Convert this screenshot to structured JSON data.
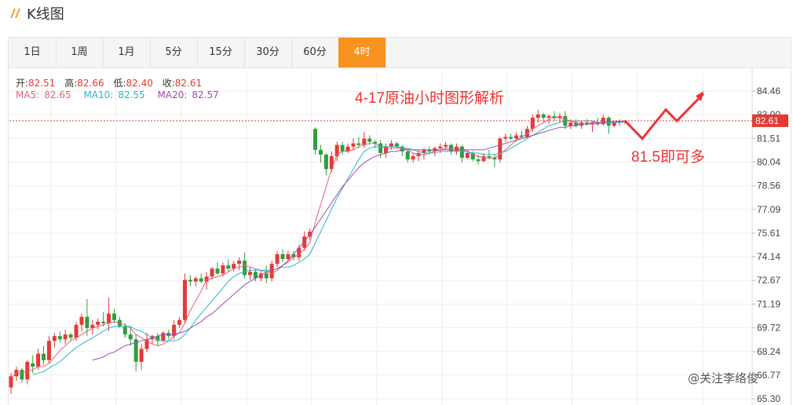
{
  "header": {
    "title": "K线图"
  },
  "tabs": [
    {
      "label": "1日",
      "active": false
    },
    {
      "label": "1周",
      "active": false
    },
    {
      "label": "1月",
      "active": false
    },
    {
      "label": "5分",
      "active": false
    },
    {
      "label": "15分",
      "active": false
    },
    {
      "label": "30分",
      "active": false
    },
    {
      "label": "60分",
      "active": false
    },
    {
      "label": "4时",
      "active": true
    }
  ],
  "ohlc": {
    "open_label": "开:",
    "open": "82.51",
    "high_label": "高:",
    "high": "82.66",
    "low_label": "低:",
    "low": "82.40",
    "close_label": "收:",
    "close": "82.61"
  },
  "ma": {
    "ma5_label": "MA5:",
    "ma5": "82.65",
    "ma10_label": "MA10:",
    "ma10": "82.55",
    "ma20_label": "MA20:",
    "ma20": "82.57"
  },
  "colors": {
    "up": "#e53935",
    "down": "#2e9e3e",
    "ma5": "#e8607a",
    "ma10": "#2bb5c8",
    "ma20": "#a44ab5",
    "accent": "#f7931e",
    "annotation": "#ee3333"
  },
  "annotations": {
    "headline": "4-17原油小时图形解析",
    "target": "81.5即可多",
    "watermark": "@关注李络俊"
  },
  "chart_data": {
    "type": "candlestick",
    "y_ticks": [
      "84.46",
      "83.00",
      "81.51",
      "80.04",
      "78.56",
      "77.09",
      "75.61",
      "74.14",
      "72.67",
      "71.19",
      "69.72",
      "68.24",
      "66.77",
      "65.30"
    ],
    "ylim": [
      65.3,
      84.46
    ],
    "current_price": "82.61",
    "grid": true,
    "candles": [
      [
        66.0,
        66.9,
        65.6,
        66.7
      ],
      [
        66.7,
        67.3,
        66.4,
        67.1
      ],
      [
        67.1,
        67.2,
        66.3,
        66.5
      ],
      [
        66.5,
        67.7,
        66.2,
        67.6
      ],
      [
        67.5,
        68.0,
        66.9,
        67.3
      ],
      [
        67.3,
        68.4,
        67.1,
        68.1
      ],
      [
        68.1,
        68.6,
        67.4,
        67.7
      ],
      [
        67.7,
        69.2,
        67.5,
        68.9
      ],
      [
        68.9,
        69.4,
        68.5,
        69.2
      ],
      [
        69.2,
        69.5,
        68.8,
        69.0
      ],
      [
        69.0,
        69.6,
        68.7,
        69.3
      ],
      [
        69.3,
        69.4,
        68.9,
        69.1
      ],
      [
        69.1,
        70.1,
        68.9,
        69.9
      ],
      [
        69.9,
        70.6,
        69.5,
        70.4
      ],
      [
        70.4,
        71.5,
        69.2,
        69.7
      ],
      [
        69.7,
        70.2,
        69.3,
        69.9
      ],
      [
        69.9,
        70.3,
        69.6,
        70.1
      ],
      [
        70.1,
        70.7,
        69.8,
        70.0
      ],
      [
        70.0,
        71.6,
        69.5,
        70.6
      ],
      [
        70.6,
        70.9,
        70.0,
        70.2
      ],
      [
        70.2,
        70.4,
        69.7,
        69.8
      ],
      [
        69.8,
        70.0,
        69.1,
        69.3
      ],
      [
        69.3,
        69.8,
        68.6,
        69.0
      ],
      [
        69.0,
        69.3,
        67.0,
        67.6
      ],
      [
        67.6,
        68.7,
        67.1,
        68.4
      ],
      [
        68.4,
        69.4,
        68.2,
        69.0
      ],
      [
        69.0,
        69.3,
        68.7,
        69.2
      ],
      [
        69.2,
        69.4,
        68.6,
        68.9
      ],
      [
        68.9,
        69.5,
        68.8,
        69.4
      ],
      [
        69.4,
        69.6,
        69.0,
        69.2
      ],
      [
        69.2,
        70.2,
        69.0,
        69.9
      ],
      [
        69.9,
        70.4,
        69.7,
        70.2
      ],
      [
        70.2,
        73.1,
        70.0,
        72.7
      ],
      [
        72.7,
        73.0,
        72.3,
        72.6
      ],
      [
        72.6,
        72.9,
        72.3,
        72.8
      ],
      [
        72.8,
        73.1,
        72.5,
        72.6
      ],
      [
        72.6,
        73.2,
        72.1,
        72.9
      ],
      [
        72.9,
        73.5,
        72.7,
        73.4
      ],
      [
        73.4,
        73.8,
        73.0,
        73.1
      ],
      [
        73.1,
        73.8,
        72.9,
        73.6
      ],
      [
        73.6,
        74.0,
        73.2,
        73.4
      ],
      [
        73.4,
        73.9,
        73.2,
        73.7
      ],
      [
        73.7,
        74.1,
        73.3,
        73.9
      ],
      [
        73.9,
        74.4,
        72.8,
        73.0
      ],
      [
        73.0,
        73.5,
        72.7,
        73.2
      ],
      [
        73.2,
        73.4,
        72.6,
        72.8
      ],
      [
        72.8,
        73.3,
        72.6,
        73.1
      ],
      [
        73.1,
        73.6,
        72.5,
        72.8
      ],
      [
        72.8,
        73.9,
        72.6,
        73.7
      ],
      [
        73.7,
        74.5,
        73.5,
        74.3
      ],
      [
        74.3,
        74.6,
        73.8,
        74.0
      ],
      [
        74.0,
        74.5,
        73.9,
        74.3
      ],
      [
        74.3,
        74.5,
        73.9,
        74.1
      ],
      [
        74.1,
        74.9,
        73.9,
        74.7
      ],
      [
        74.7,
        75.7,
        74.5,
        75.4
      ],
      [
        75.4,
        75.9,
        75.2,
        75.7
      ],
      [
        82.1,
        82.2,
        80.5,
        80.8
      ],
      [
        80.8,
        81.1,
        80.0,
        80.5
      ],
      [
        80.5,
        80.6,
        79.2,
        79.6
      ],
      [
        79.6,
        80.7,
        79.4,
        80.4
      ],
      [
        80.4,
        81.3,
        80.1,
        81.1
      ],
      [
        81.1,
        81.3,
        80.5,
        80.7
      ],
      [
        80.7,
        81.2,
        80.6,
        81.0
      ],
      [
        81.0,
        81.5,
        80.8,
        81.2
      ],
      [
        81.2,
        81.6,
        80.9,
        81.1
      ],
      [
        81.1,
        81.9,
        80.9,
        81.5
      ],
      [
        81.5,
        81.7,
        81.1,
        81.3
      ],
      [
        81.3,
        81.4,
        80.9,
        81.2
      ],
      [
        81.2,
        81.4,
        80.3,
        80.6
      ],
      [
        80.6,
        81.2,
        80.3,
        81.0
      ],
      [
        81.0,
        81.4,
        80.8,
        81.2
      ],
      [
        81.2,
        81.3,
        80.9,
        81.0
      ],
      [
        81.0,
        81.1,
        80.4,
        80.7
      ],
      [
        80.7,
        80.9,
        80.0,
        80.2
      ],
      [
        80.2,
        80.6,
        80.0,
        80.4
      ],
      [
        80.4,
        80.8,
        80.1,
        80.6
      ],
      [
        80.6,
        80.9,
        80.2,
        80.8
      ],
      [
        80.8,
        81.0,
        80.5,
        80.7
      ],
      [
        80.7,
        81.0,
        80.4,
        80.9
      ],
      [
        80.9,
        81.2,
        80.6,
        81.0
      ],
      [
        81.0,
        81.3,
        80.8,
        81.1
      ],
      [
        81.1,
        81.2,
        80.5,
        80.7
      ],
      [
        80.7,
        81.2,
        80.5,
        81.0
      ],
      [
        81.0,
        81.1,
        80.0,
        80.3
      ],
      [
        80.3,
        80.8,
        80.2,
        80.6
      ],
      [
        80.6,
        80.7,
        80.1,
        80.2
      ],
      [
        80.2,
        80.5,
        79.9,
        80.1
      ],
      [
        80.1,
        80.6,
        80.0,
        80.4
      ],
      [
        80.4,
        80.8,
        80.2,
        80.3
      ],
      [
        80.3,
        80.5,
        79.7,
        80.2
      ],
      [
        80.2,
        81.6,
        80.0,
        81.5
      ],
      [
        81.5,
        81.8,
        81.3,
        81.6
      ],
      [
        81.6,
        81.8,
        81.4,
        81.5
      ],
      [
        81.5,
        81.9,
        81.3,
        81.7
      ],
      [
        81.7,
        82.0,
        81.5,
        81.6
      ],
      [
        81.6,
        82.3,
        81.5,
        82.1
      ],
      [
        82.1,
        83.0,
        81.9,
        82.8
      ],
      [
        82.8,
        83.3,
        82.5,
        83.0
      ],
      [
        83.0,
        83.1,
        82.5,
        82.8
      ],
      [
        82.8,
        83.0,
        82.4,
        82.9
      ],
      [
        82.9,
        83.2,
        82.6,
        82.8
      ],
      [
        82.8,
        83.1,
        82.5,
        82.9
      ],
      [
        82.9,
        83.2,
        82.1,
        82.3
      ],
      [
        82.3,
        82.7,
        82.1,
        82.5
      ],
      [
        82.5,
        82.7,
        82.2,
        82.3
      ],
      [
        82.3,
        82.6,
        82.1,
        82.5
      ],
      [
        82.5,
        82.7,
        82.3,
        82.4
      ],
      [
        82.4,
        82.6,
        81.9,
        82.5
      ],
      [
        82.5,
        82.8,
        82.3,
        82.4
      ],
      [
        82.4,
        83.0,
        82.3,
        82.8
      ],
      [
        82.8,
        82.9,
        81.8,
        82.3
      ],
      [
        82.3,
        82.6,
        82.2,
        82.5
      ],
      [
        82.5,
        82.7,
        82.3,
        82.6
      ],
      [
        82.51,
        82.66,
        82.4,
        82.61
      ]
    ],
    "ma5": [
      66.6,
      66.9,
      66.9,
      67.0,
      67.1,
      67.3,
      67.3,
      67.5,
      67.9,
      68.3,
      68.6,
      68.9,
      69.1,
      69.3,
      69.5,
      69.7,
      69.8,
      69.9,
      70.0,
      70.1,
      70.0,
      69.9,
      69.7,
      69.3,
      69.1,
      68.9,
      68.7,
      68.6,
      68.7,
      68.9,
      69.2,
      69.4,
      70.0,
      70.8,
      71.4,
      72.0,
      72.7,
      72.8,
      72.9,
      73.0,
      73.2,
      73.4,
      73.5,
      73.6,
      73.5,
      73.4,
      73.3,
      73.2,
      73.1,
      73.3,
      73.6,
      73.8,
      74.1,
      74.3,
      74.6,
      75.0,
      76.3,
      77.4,
      78.5,
      79.6,
      80.5,
      80.7,
      80.7,
      80.8,
      81.0,
      81.1,
      81.2,
      81.2,
      81.0,
      80.9,
      80.9,
      80.9,
      80.9,
      80.8,
      80.6,
      80.5,
      80.5,
      80.6,
      80.7,
      80.8,
      80.9,
      80.9,
      80.9,
      80.8,
      80.7,
      80.5,
      80.4,
      80.3,
      80.3,
      80.3,
      80.5,
      80.8,
      81.1,
      81.4,
      81.6,
      81.8,
      82.1,
      82.3,
      82.5,
      82.7,
      82.8,
      82.8,
      82.7,
      82.6,
      82.5,
      82.4,
      82.4,
      82.4,
      82.4,
      82.5,
      82.5,
      82.5,
      82.5,
      82.6
    ],
    "ma10": [
      null,
      null,
      null,
      null,
      66.8,
      66.9,
      67.0,
      67.2,
      67.4,
      67.6,
      67.9,
      68.2,
      68.5,
      68.7,
      68.9,
      69.1,
      69.3,
      69.5,
      69.7,
      69.8,
      69.8,
      69.8,
      69.8,
      69.6,
      69.5,
      69.3,
      69.1,
      69.0,
      68.9,
      68.9,
      68.9,
      69.0,
      69.3,
      69.7,
      70.2,
      70.6,
      71.0,
      71.4,
      71.8,
      72.2,
      72.6,
      72.9,
      73.1,
      73.2,
      73.3,
      73.3,
      73.3,
      73.3,
      73.3,
      73.4,
      73.5,
      73.5,
      73.6,
      73.8,
      74.0,
      74.3,
      75.0,
      75.7,
      76.4,
      77.1,
      77.8,
      78.4,
      79.0,
      79.6,
      80.2,
      80.7,
      80.9,
      81.0,
      81.0,
      81.0,
      81.0,
      81.0,
      80.9,
      80.9,
      80.8,
      80.7,
      80.6,
      80.6,
      80.6,
      80.7,
      80.7,
      80.7,
      80.7,
      80.7,
      80.7,
      80.6,
      80.6,
      80.5,
      80.5,
      80.5,
      80.6,
      80.7,
      80.9,
      81.1,
      81.3,
      81.5,
      81.7,
      81.9,
      82.1,
      82.3,
      82.4,
      82.5,
      82.6,
      82.6,
      82.6,
      82.6,
      82.6,
      82.6,
      82.5,
      82.5,
      82.5,
      82.5,
      82.5,
      82.55
    ],
    "ma20": [
      null,
      null,
      null,
      null,
      null,
      null,
      null,
      null,
      null,
      null,
      null,
      null,
      null,
      null,
      null,
      67.7,
      67.8,
      67.9,
      68.1,
      68.2,
      68.4,
      68.6,
      68.7,
      68.8,
      68.9,
      69.0,
      69.1,
      69.2,
      69.3,
      69.3,
      69.3,
      69.4,
      69.5,
      69.7,
      69.9,
      70.1,
      70.4,
      70.6,
      70.9,
      71.2,
      71.5,
      71.8,
      72.1,
      72.4,
      72.6,
      72.8,
      73.0,
      73.2,
      73.3,
      73.4,
      73.6,
      73.9,
      74.3,
      74.7,
      75.1,
      75.5,
      76.0,
      76.5,
      77.0,
      77.5,
      78.0,
      78.5,
      78.9,
      79.3,
      79.7,
      80.0,
      80.2,
      80.4,
      80.5,
      80.6,
      80.7,
      80.7,
      80.8,
      80.8,
      80.8,
      80.8,
      80.8,
      80.8,
      80.8,
      80.8,
      80.8,
      80.8,
      80.8,
      80.8,
      80.8,
      80.8,
      80.8,
      80.8,
      80.9,
      81.0,
      81.1,
      81.2,
      81.3,
      81.4,
      81.5,
      81.6,
      81.7,
      81.8,
      81.9,
      82.0,
      82.1,
      82.2,
      82.2,
      82.3,
      82.3,
      82.4,
      82.4,
      82.5,
      82.5,
      82.5,
      82.55,
      82.56,
      82.57,
      82.57
    ],
    "projection": [
      82.61,
      81.5,
      83.3,
      82.6,
      84.3
    ]
  }
}
